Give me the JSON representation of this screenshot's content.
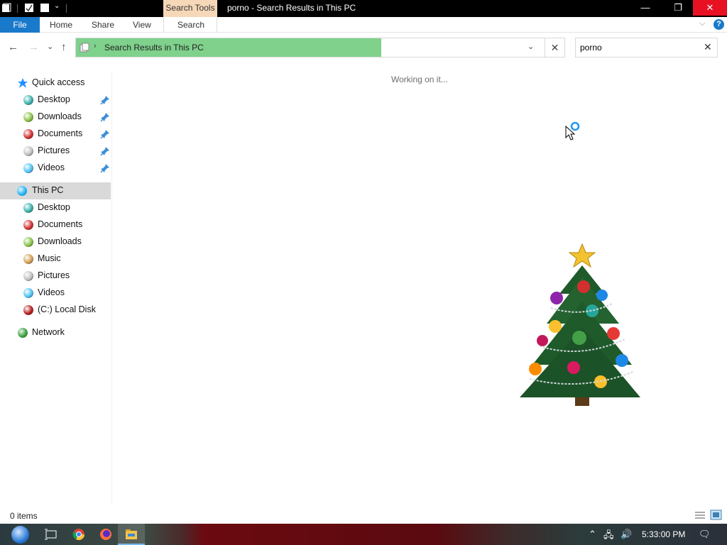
{
  "titlebar": {
    "contextual_tab": "Search Tools",
    "window_title": "porno - Search Results in This PC",
    "minimize_glyph": "—",
    "maximize_glyph": "❐",
    "close_glyph": "✕"
  },
  "ribbon": {
    "file": "File",
    "home": "Home",
    "share": "Share",
    "view": "View",
    "search": "Search",
    "expand_glyph": "⌵",
    "help_glyph": "?"
  },
  "nav": {
    "back_glyph": "←",
    "forward_glyph": "→",
    "recent_glyph": "⌄",
    "up_glyph": "↑"
  },
  "address": {
    "chevron": "›",
    "path": "Search Results in This PC",
    "progress": 0.625,
    "dropdown_glyph": "⌄",
    "cancel_glyph": "✕"
  },
  "search": {
    "query": "porno",
    "clear_glyph": "✕"
  },
  "navpane": {
    "quick_access": {
      "label": "Quick access",
      "icon": "star-icon",
      "color": "#1e90ff"
    },
    "quick_items": [
      {
        "label": "Desktop",
        "icon": "desktop-icon",
        "color": "#38b2ac"
      },
      {
        "label": "Downloads",
        "icon": "downloads-icon",
        "color": "#8bc34a"
      },
      {
        "label": "Documents",
        "icon": "documents-icon",
        "color": "#d32f2f"
      },
      {
        "label": "Pictures",
        "icon": "pictures-icon",
        "color": "#c0c0c0"
      },
      {
        "label": "Videos",
        "icon": "videos-icon",
        "color": "#4fc3f7"
      }
    ],
    "this_pc": {
      "label": "This PC",
      "icon": "this-pc-icon",
      "color": "#29b6f6"
    },
    "pc_items": [
      {
        "label": "Desktop",
        "icon": "desktop-icon",
        "color": "#38b2ac"
      },
      {
        "label": "Documents",
        "icon": "documents-icon",
        "color": "#d32f2f"
      },
      {
        "label": "Downloads",
        "icon": "downloads-icon",
        "color": "#8bc34a"
      },
      {
        "label": "Music",
        "icon": "music-icon",
        "color": "#d4a056"
      },
      {
        "label": "Pictures",
        "icon": "pictures-icon",
        "color": "#c0c0c0"
      },
      {
        "label": "Videos",
        "icon": "videos-icon",
        "color": "#4fc3f7"
      },
      {
        "label": "(C:) Local Disk",
        "icon": "local-disk-icon",
        "color": "#b71c1c"
      }
    ],
    "network": {
      "label": "Network",
      "icon": "network-icon",
      "color": "#43a047"
    }
  },
  "content": {
    "status_message": "Working on it..."
  },
  "statusbar": {
    "item_count": "0 items"
  },
  "taskbar": {
    "clock": "5:33:00 PM",
    "tray_chevron": "⌃",
    "network_glyph": "🖧",
    "volume_glyph": "🔊",
    "notifications_glyph": "🗨"
  },
  "colors": {
    "file_tab": "#1979ca",
    "contextual_tab": "#f6d7b8",
    "close_button": "#e81123",
    "address_progress": "#7fd18c",
    "selected_nav": "#d9d9d9"
  }
}
